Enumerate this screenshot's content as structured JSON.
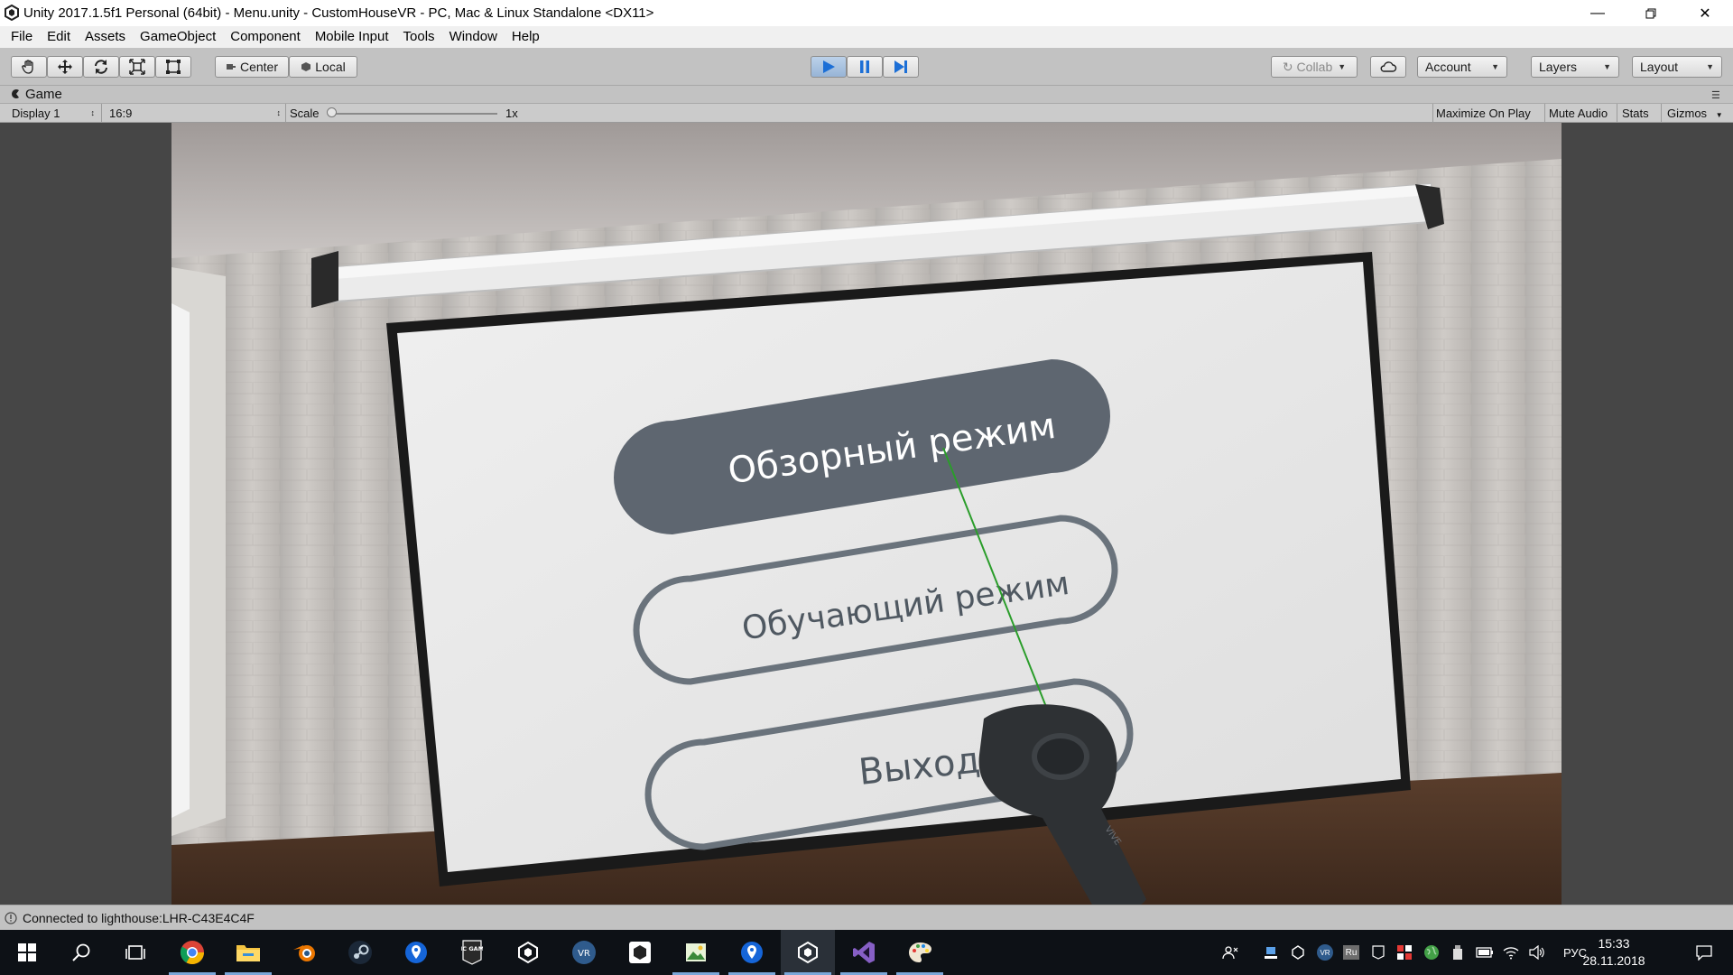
{
  "window": {
    "title": "Unity 2017.1.5f1 Personal (64bit) - Menu.unity - CustomHouseVR - PC, Mac & Linux Standalone <DX11>",
    "controls": [
      "minimize-icon",
      "restore-icon",
      "close-icon"
    ]
  },
  "menu": [
    "File",
    "Edit",
    "Assets",
    "GameObject",
    "Component",
    "Mobile Input",
    "Tools",
    "Window",
    "Help"
  ],
  "toolbar": {
    "transform_tools": [
      "hand-icon",
      "move-icon",
      "rotate-icon",
      "scale-icon",
      "rect-icon"
    ],
    "pivot_label": "Center",
    "space_label": "Local",
    "play_state": "playing",
    "collab_label": "Collab",
    "account_label": "Account",
    "layers_label": "Layers",
    "layout_label": "Layout"
  },
  "game_tab": {
    "title": "Game",
    "display": "Display 1",
    "aspect": "16:9",
    "scale_label": "Scale",
    "scale_value": "1x",
    "scale_level": 0,
    "toggles": [
      "Maximize On Play",
      "Mute Audio",
      "Stats",
      "Gizmos"
    ]
  },
  "scene": {
    "menu_buttons": [
      {
        "label": "Обзорный режим",
        "state": "highlighted"
      },
      {
        "label": "Обучающий режим",
        "state": "normal"
      },
      {
        "label": "Выход",
        "state": "normal"
      }
    ],
    "laser_color": "#2a9d2a",
    "controller_text": "VIVE"
  },
  "status": {
    "message": "Connected to lighthouse:LHR-C43E4C4F"
  },
  "taskbar": {
    "apps": [
      "chrome-icon",
      "file-explorer-icon",
      "blender-icon",
      "steam-icon",
      "maps-pin-icon",
      "epic-games-icon",
      "unity-icon",
      "steamvr-icon",
      "unity-hub-icon",
      "image-editor-icon",
      "maps-pin-icon",
      "unity-editor-icon",
      "visual-studio-icon",
      "paint-icon"
    ],
    "epic_label": "EPIC GAMES",
    "vr_label": "VR",
    "tray_ru": "Ru",
    "language": "РУС",
    "time": "15:33",
    "date": "28.11.2018"
  },
  "colors": {
    "accent": "#3d7bc6",
    "selected_button": "#5e6670",
    "button_outline": "#6a737c"
  }
}
